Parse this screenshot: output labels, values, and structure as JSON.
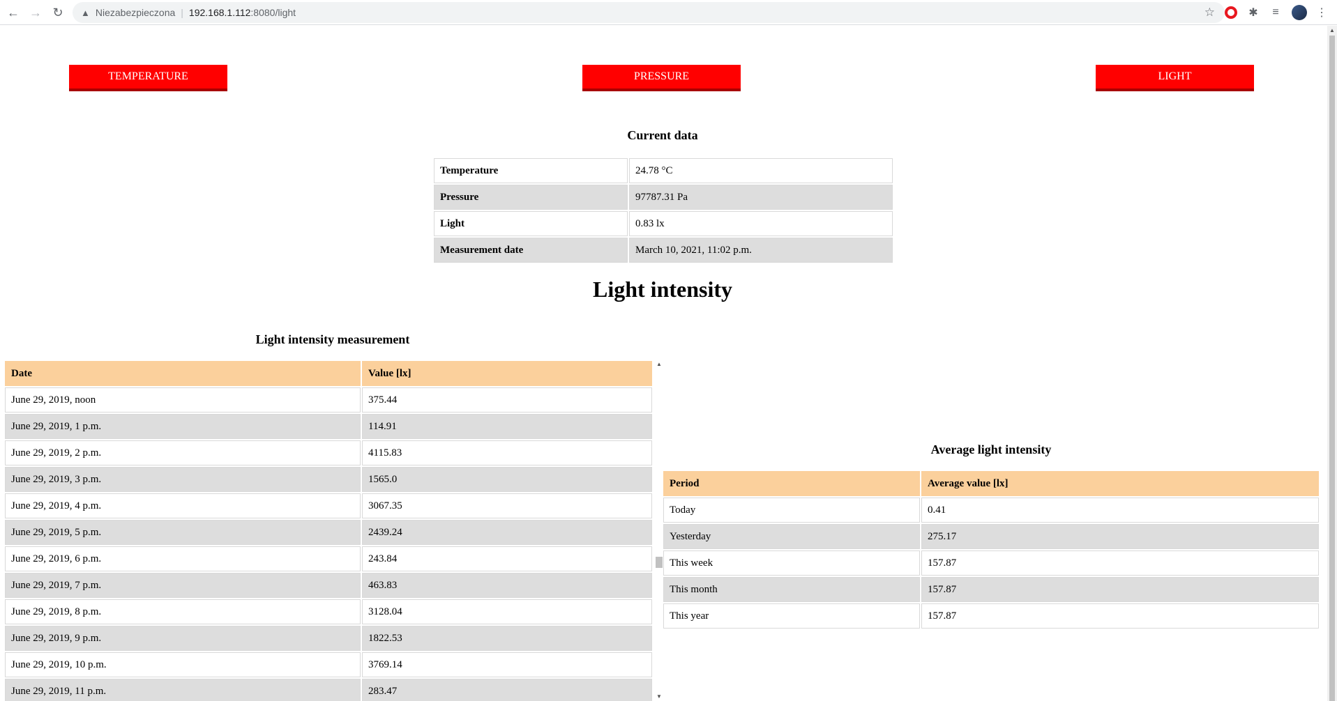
{
  "browser": {
    "back_icon": "←",
    "forward_icon": "→",
    "reload_icon": "↻",
    "warning_icon": "▲",
    "security_status": "Niezabezpieczona",
    "url_host": "192.168.1.112",
    "url_path": ":8080/light",
    "star_icon": "☆",
    "puzzle_icon": "✱",
    "media_icon": "≡",
    "menu_icon": "⋮"
  },
  "nav": {
    "temperature": "TEMPERATURE",
    "pressure": "PRESSURE",
    "light": "LIGHT"
  },
  "current": {
    "heading": "Current data",
    "rows": [
      {
        "label": "Temperature",
        "value": "24.78 °C"
      },
      {
        "label": "Pressure",
        "value": "97787.31 Pa"
      },
      {
        "label": "Light",
        "value": "0.83 lx"
      },
      {
        "label": "Measurement date",
        "value": "March 10, 2021, 11:02 p.m."
      }
    ]
  },
  "page_title": "Light intensity",
  "measurement": {
    "heading": "Light intensity measurement",
    "col_date": "Date",
    "col_value": "Value [lx]",
    "rows": [
      {
        "date": "June 29, 2019, noon",
        "value": "375.44"
      },
      {
        "date": "June 29, 2019, 1 p.m.",
        "value": "114.91"
      },
      {
        "date": "June 29, 2019, 2 p.m.",
        "value": "4115.83"
      },
      {
        "date": "June 29, 2019, 3 p.m.",
        "value": "1565.0"
      },
      {
        "date": "June 29, 2019, 4 p.m.",
        "value": "3067.35"
      },
      {
        "date": "June 29, 2019, 5 p.m.",
        "value": "2439.24"
      },
      {
        "date": "June 29, 2019, 6 p.m.",
        "value": "243.84"
      },
      {
        "date": "June 29, 2019, 7 p.m.",
        "value": "463.83"
      },
      {
        "date": "June 29, 2019, 8 p.m.",
        "value": "3128.04"
      },
      {
        "date": "June 29, 2019, 9 p.m.",
        "value": "1822.53"
      },
      {
        "date": "June 29, 2019, 10 p.m.",
        "value": "3769.14"
      },
      {
        "date": "June 29, 2019, 11 p.m.",
        "value": "283.47"
      }
    ]
  },
  "average": {
    "heading": "Average light intensity",
    "col_period": "Period",
    "col_value": "Average value [lx]",
    "rows": [
      {
        "period": "Today",
        "value": "0.41"
      },
      {
        "period": "Yesterday",
        "value": "275.17"
      },
      {
        "period": "This week",
        "value": "157.87"
      },
      {
        "period": "This month",
        "value": "157.87"
      },
      {
        "period": "This year",
        "value": "157.87"
      }
    ]
  },
  "colors": {
    "nav_button": "#ff0000",
    "table_header": "#fbd09c",
    "row_alt": "#dddddd"
  }
}
